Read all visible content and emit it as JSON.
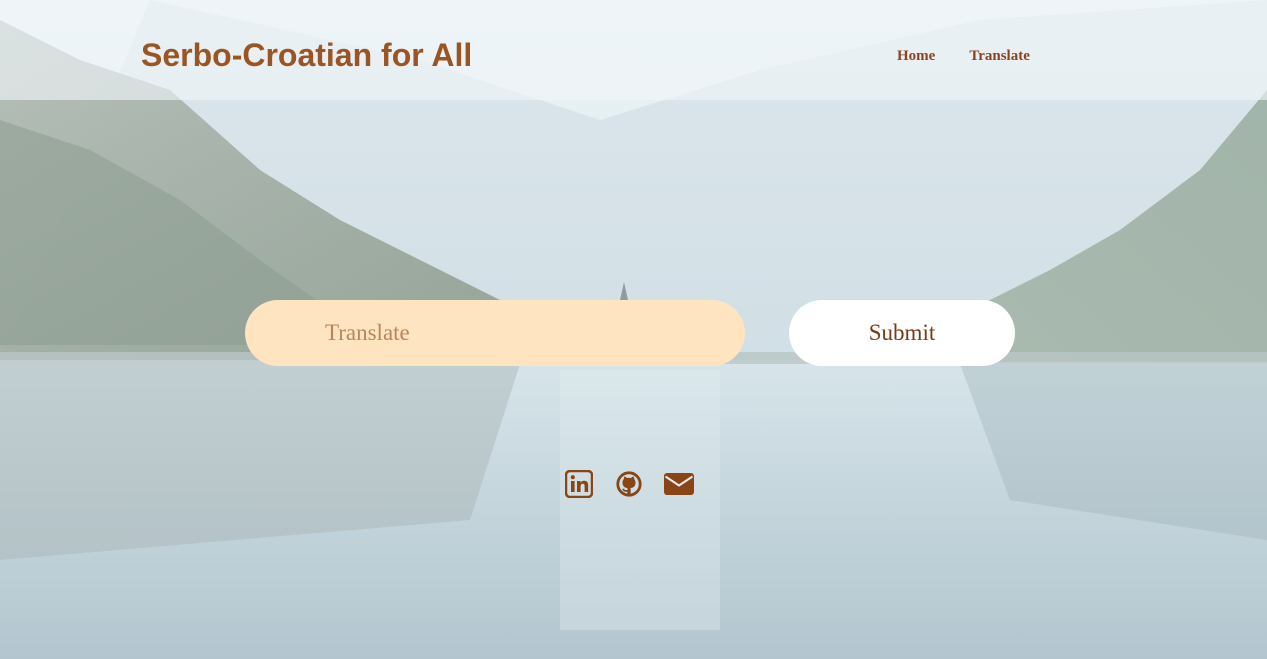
{
  "header": {
    "brand": "Serbo-Croatian for All",
    "nav": [
      {
        "label": "Home"
      },
      {
        "label": "Translate"
      }
    ]
  },
  "form": {
    "input_placeholder": "Translate",
    "input_value": "",
    "submit_label": "Submit"
  },
  "socials": [
    {
      "icon": "linkedin-icon"
    },
    {
      "icon": "github-icon"
    },
    {
      "icon": "envelope-icon"
    }
  ],
  "colors": {
    "brand": "#9a5524",
    "nav_link": "#8a4520",
    "input_background": "#ffe4c2",
    "button_background": "#ffffff",
    "icon": "#8a4516"
  }
}
